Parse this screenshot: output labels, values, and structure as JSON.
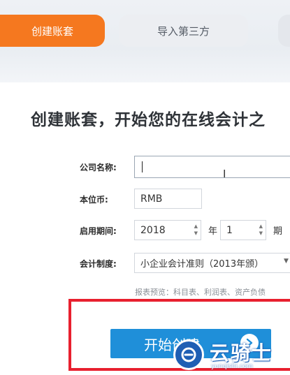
{
  "tabs": {
    "create_account": "创建账套",
    "import_third_party": "导入第三方"
  },
  "page_title": "创建账套，开始您的在线会计之",
  "form": {
    "company_name": {
      "label": "公司名称:",
      "value": ""
    },
    "base_currency": {
      "label": "本位币:",
      "value": "RMB"
    },
    "start_period": {
      "label": "启用期间:",
      "year": "2018",
      "year_unit": "年",
      "month": "1",
      "month_unit": "期"
    },
    "accounting_system": {
      "label": "会计制度:",
      "value": "小企业会计准则（2013年颁）"
    },
    "report_preview": "报表预览：科目表、利润表、资产负债"
  },
  "start_button": {
    "label": "开始创建"
  },
  "watermark": {
    "text": "云骑士",
    "url": "yunqishi.com"
  },
  "colors": {
    "active_tab": "#f5781f",
    "primary_button": "#1f8fd9",
    "highlight_frame": "#e8202f"
  }
}
